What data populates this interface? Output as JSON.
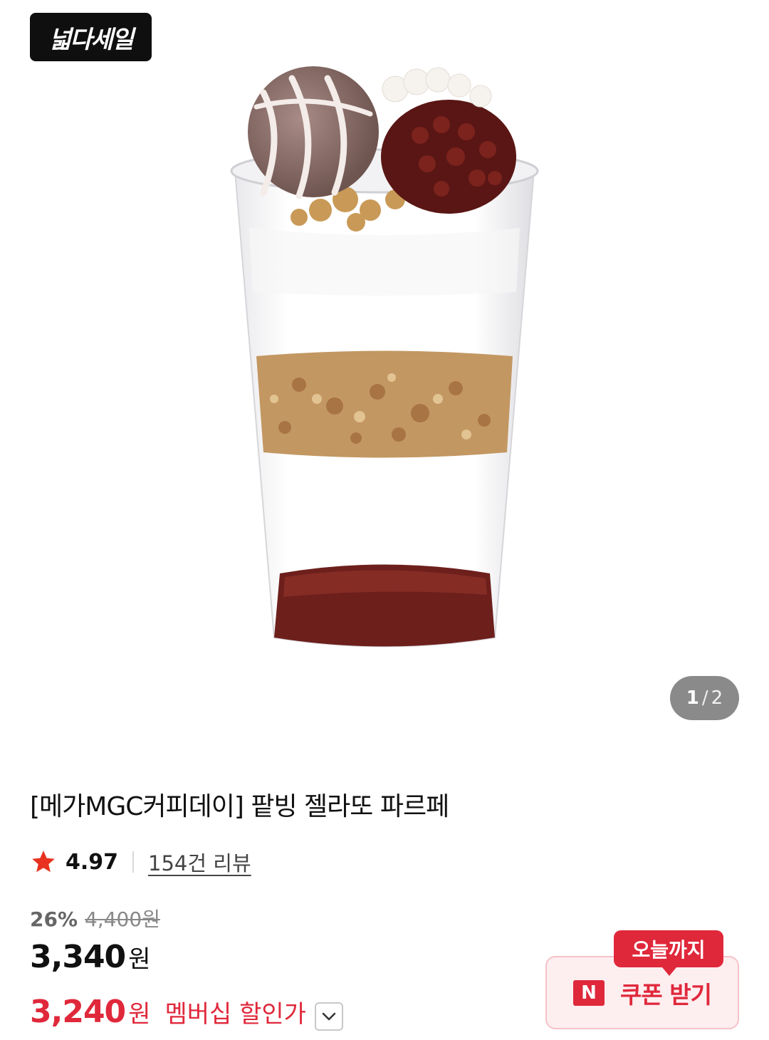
{
  "hero": {
    "sale_logo": "넓다세일",
    "image_alt": "팥빙 젤라또 파르페",
    "page_current": "1",
    "page_separator": "/",
    "page_total": "2"
  },
  "product": {
    "title": "[메가MGC커피데이] 팥빙 젤라또 파르페",
    "rating": "4.97",
    "review_text": "154건 리뷰",
    "discount": "26%",
    "original_price": "4,400원",
    "price": "3,340",
    "price_unit": "원",
    "member_price": "3,240",
    "member_unit": "원",
    "member_label": "멤버십 할인가"
  },
  "coupon": {
    "badge": "오늘까지",
    "n_icon": "N",
    "label": "쿠폰 받기"
  },
  "icons": {
    "star": "star-icon",
    "chevron": "chevron-down-icon"
  },
  "colors": {
    "accent_red": "#e0283b",
    "star_red": "#e8321f",
    "coupon_bg": "#fdeef0"
  }
}
